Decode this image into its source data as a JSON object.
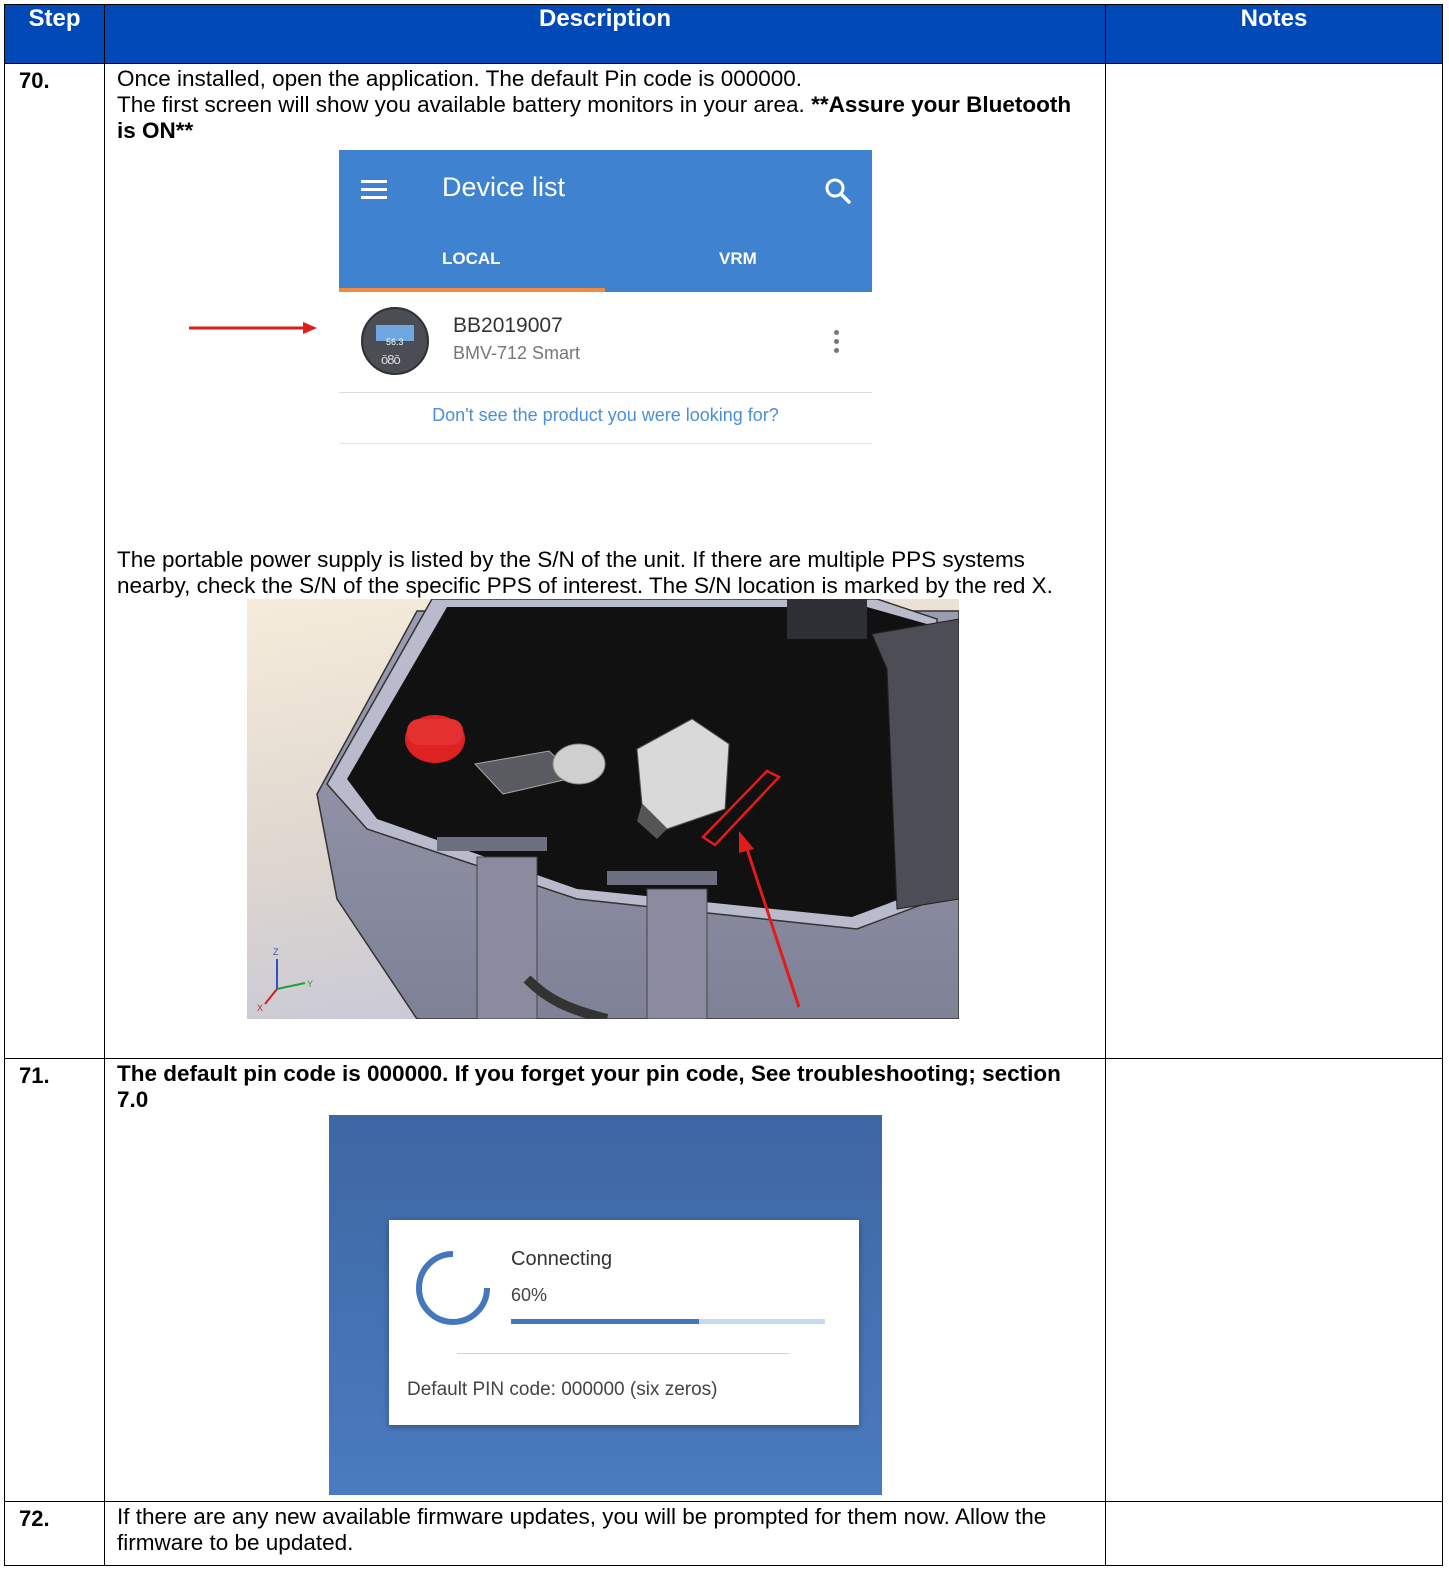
{
  "header": {
    "step": "Step",
    "description": "Description",
    "notes": "Notes"
  },
  "rows": [
    {
      "step": "70.",
      "p1": "Once installed, open the application.  The default Pin code is 000000.",
      "p2_plain": "The first screen will show you available battery monitors in your area. ",
      "p2_bold": "**Assure your Bluetooth is ON**",
      "device_list": {
        "title": "Device list",
        "tabs": [
          "LOCAL",
          "VRM"
        ],
        "active_tab": "LOCAL",
        "device_name": "BB2019007",
        "device_model": "BMV-712 Smart",
        "screen_reading": "56.3",
        "link": "Don't see the product you were looking for?",
        "tab_color": "#3f82cf",
        "underline_color": "#f08a3c"
      },
      "p3": "The portable power supply is listed by the S/N of the unit. If there are multiple PPS systems nearby, check the S/N of the specific PPS of interest. The S/N location is marked by the red X."
    },
    {
      "step": "71.",
      "text_bold": "The default pin code is 000000. If you forget your pin code, See troubleshooting; section 7.0",
      "connect": {
        "title": "Connecting",
        "percent_label": "60%",
        "progress": 0.6,
        "pin_text": "Default PIN code: 000000 (six zeros)"
      }
    },
    {
      "step": "72.",
      "text": "If there are any new available firmware updates, you will be prompted for them now. Allow the firmware to be updated."
    }
  ],
  "colors": {
    "header_bg": "#0049b7",
    "arrow_red": "#e21b1b"
  }
}
